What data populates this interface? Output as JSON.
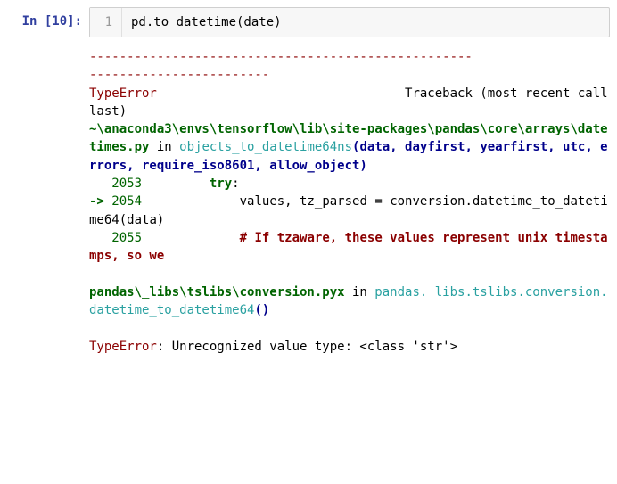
{
  "cell": {
    "prompt_label": "In [10]:",
    "line_number": "1",
    "code": "pd.to_datetime(date)"
  },
  "traceback": {
    "dashes1": "---------------------------------------------------",
    "dashes2": "------------------------",
    "error_name": "TypeError",
    "traceback_word": "Traceback (most recent call last)",
    "frame1_path": "~\\anaconda3\\envs\\tensorflow\\lib\\site-packages\\pandas\\core\\arrays\\datetimes.py",
    "in_word1": " in ",
    "frame1_func": "objects_to_datetime64ns",
    "frame1_sig": "(data, dayfirst, yearfirst, utc, errors, require_iso8601, allow_object)",
    "line2053_no": "   2053 ",
    "line2053_code": "        try",
    "line2053_colon": ":",
    "arrow": "-> ",
    "line2054_no": "2054 ",
    "line2054_code_a": "            values",
    "line2054_code_b": ",",
    "line2054_code_c": " tz_parsed ",
    "line2054_code_d": "=",
    "line2054_code_e": " conversion",
    "line2054_code_f": ".",
    "line2054_code_g": "datetime_to_datetime64",
    "line2054_code_h": "(",
    "line2054_code_i": "data",
    "line2054_code_j": ")",
    "line2055_no": "   2055 ",
    "line2055_comment": "            # If tzaware, these values represent unix timestamps, so we",
    "frame2_path": "pandas\\_libs\\tslibs\\conversion.pyx",
    "in_word2": " in ",
    "frame2_func": "pandas._libs.tslibs.conversion.datetime_to_datetime64",
    "frame2_parens": "()",
    "final_error": "TypeError",
    "final_msg": ": Unrecognized value type: <class 'str'>",
    "spaces_gap": "                                 "
  }
}
